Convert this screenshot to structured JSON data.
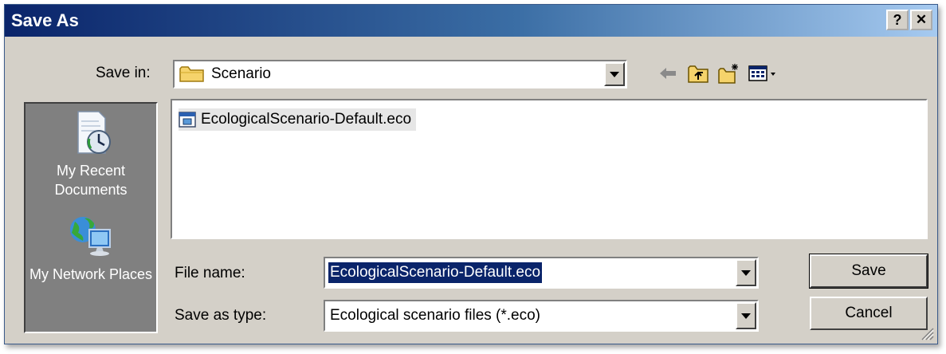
{
  "window": {
    "title": "Save As",
    "help_btn": "?",
    "close_btn": "✕"
  },
  "save_in": {
    "label": "Save in:",
    "value": "Scenario"
  },
  "places": [
    {
      "label": "My Recent Documents",
      "icon": "recent-documents-icon"
    },
    {
      "label": "My Network Places",
      "icon": "network-places-icon"
    }
  ],
  "files": [
    {
      "name": "EcologicalScenario-Default.eco",
      "icon": "eco-file-icon"
    }
  ],
  "file_name": {
    "label": "File name:",
    "value": "EcologicalScenario-Default.eco"
  },
  "save_type": {
    "label": "Save as type:",
    "value": "Ecological scenario files (*.eco)"
  },
  "buttons": {
    "save": "Save",
    "cancel": "Cancel"
  },
  "colors": {
    "title_start": "#0a246a",
    "title_end": "#a6caf0",
    "selection": "#0a246a",
    "face": "#d4d0c8"
  }
}
